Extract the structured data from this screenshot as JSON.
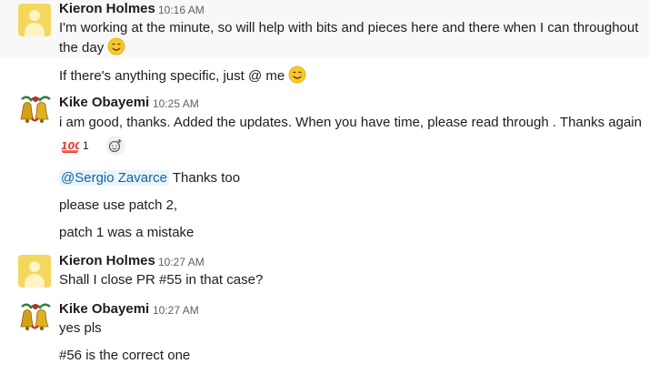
{
  "messages": [
    {
      "author": "Kieron Holmes",
      "time": "10:16 AM",
      "lines": [
        "I'm working at the minute, so will help with bits and pieces here and there when I can throughout",
        "the day"
      ],
      "followups": [
        "If there's anything specific, just @ me"
      ]
    },
    {
      "author": "Kike Obayemi",
      "time": "10:25 AM",
      "lines": [
        "i am good, thanks. Added the updates. When you have time, please read through . Thanks again"
      ],
      "reaction": {
        "emoji": "100",
        "count": "1"
      },
      "followups": [
        "Thanks too",
        "please use patch 2,",
        "patch 1 was a mistake"
      ],
      "mention": "@Sergio Zavarce"
    },
    {
      "author": "Kieron Holmes",
      "time": "10:27 AM",
      "lines": [
        "Shall I close PR #55 in that case?"
      ]
    },
    {
      "author": "Kike Obayemi",
      "time": "10:27 AM",
      "lines": [
        "yes pls"
      ],
      "followups": [
        "#56 is the correct one"
      ]
    }
  ],
  "icons": {
    "smile": "smiling-face-emoji",
    "hundred": "hundred-points-emoji",
    "add_reaction": "add-reaction-icon",
    "avatar_bells": "christmas-bells-avatar",
    "avatar_default": "default-user-avatar"
  }
}
